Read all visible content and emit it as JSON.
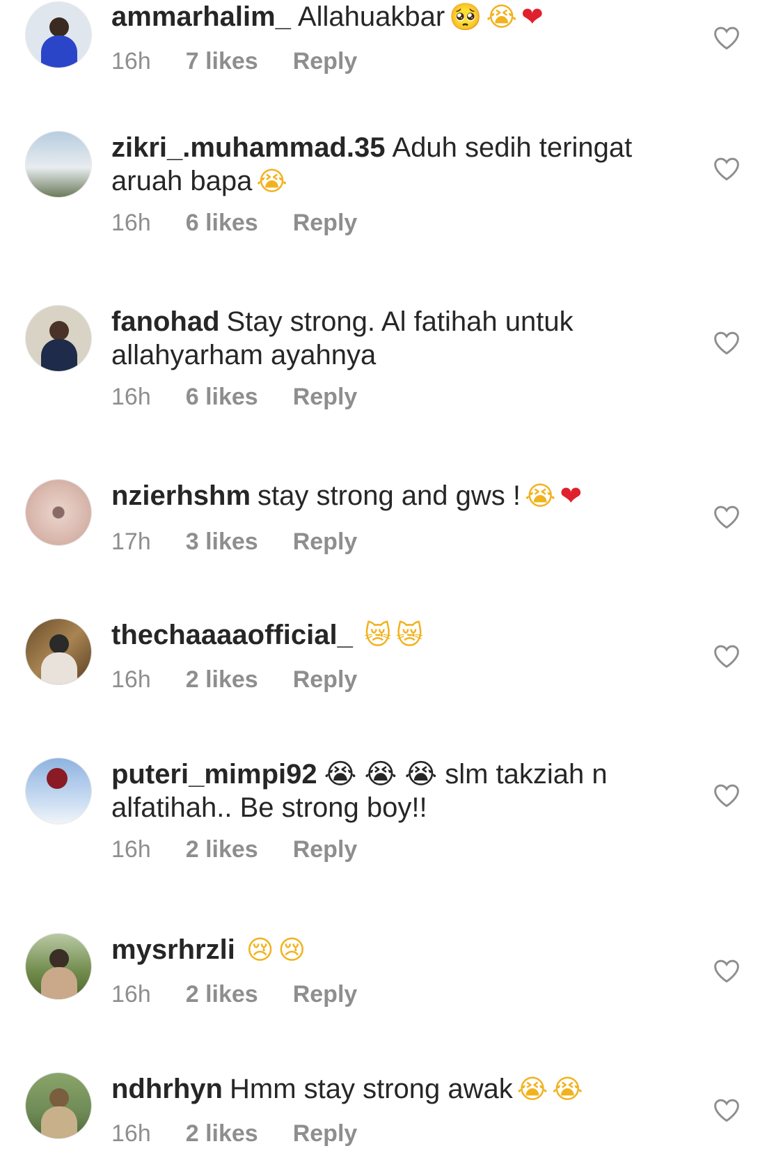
{
  "comments": [
    {
      "username": "ammarhalim_",
      "text": "Allahuakbar",
      "emojis": [
        "🥺",
        "😭",
        "❤"
      ],
      "time": "16h",
      "likes": "7 likes",
      "reply": "Reply",
      "avatar_colors": [
        "#dfe6ee",
        "#2b45c8"
      ]
    },
    {
      "username": "zikri_.muhammad.35",
      "text": "Aduh sedih teringat aruah bapa",
      "emojis": [
        "😭"
      ],
      "time": "16h",
      "likes": "6 likes",
      "reply": "Reply",
      "avatar_colors": [
        "#a9c2d8",
        "#6b7a5a"
      ]
    },
    {
      "username": "fanohad",
      "text": "Stay strong. Al fatihah untuk allahyarham ayahnya",
      "emojis": [],
      "time": "16h",
      "likes": "6 likes",
      "reply": "Reply",
      "avatar_colors": [
        "#d8d3c4",
        "#1f2b4a"
      ]
    },
    {
      "username": "nzierhshm",
      "text": "stay strong and gws !",
      "emojis": [
        "😭",
        "❤"
      ],
      "time": "17h",
      "likes": "3 likes",
      "reply": "Reply",
      "avatar_colors": [
        "#d9b7ad",
        "#b08a80"
      ]
    },
    {
      "username": "thechaaaaofficial_",
      "text": "",
      "emojis": [
        "😿",
        "😿"
      ],
      "time": "16h",
      "likes": "2 likes",
      "reply": "Reply",
      "avatar_colors": [
        "#8a6a3e",
        "#e8e2da"
      ]
    },
    {
      "username": "puteri_mimpi92",
      "text": "😭 😭 😭 slm takziah n alfatihah.. Be strong boy!!",
      "emojis": [],
      "time": "16h",
      "likes": "2 likes",
      "reply": "Reply",
      "avatar_colors": [
        "#a9c6ee",
        "#8a1a24"
      ]
    },
    {
      "username": "mysrhrzli",
      "text": "",
      "emojis": [
        "😢",
        "😢"
      ],
      "time": "16h",
      "likes": "2 likes",
      "reply": "Reply",
      "avatar_colors": [
        "#6f8a4a",
        "#3a2e26"
      ]
    },
    {
      "username": "ndhrhyn",
      "text": "Hmm stay strong awak",
      "emojis": [
        "😭",
        "😭"
      ],
      "time": "16h",
      "likes": "2 likes",
      "reply": "Reply",
      "avatar_colors": [
        "#6e8a56",
        "#c7b08a"
      ]
    }
  ]
}
